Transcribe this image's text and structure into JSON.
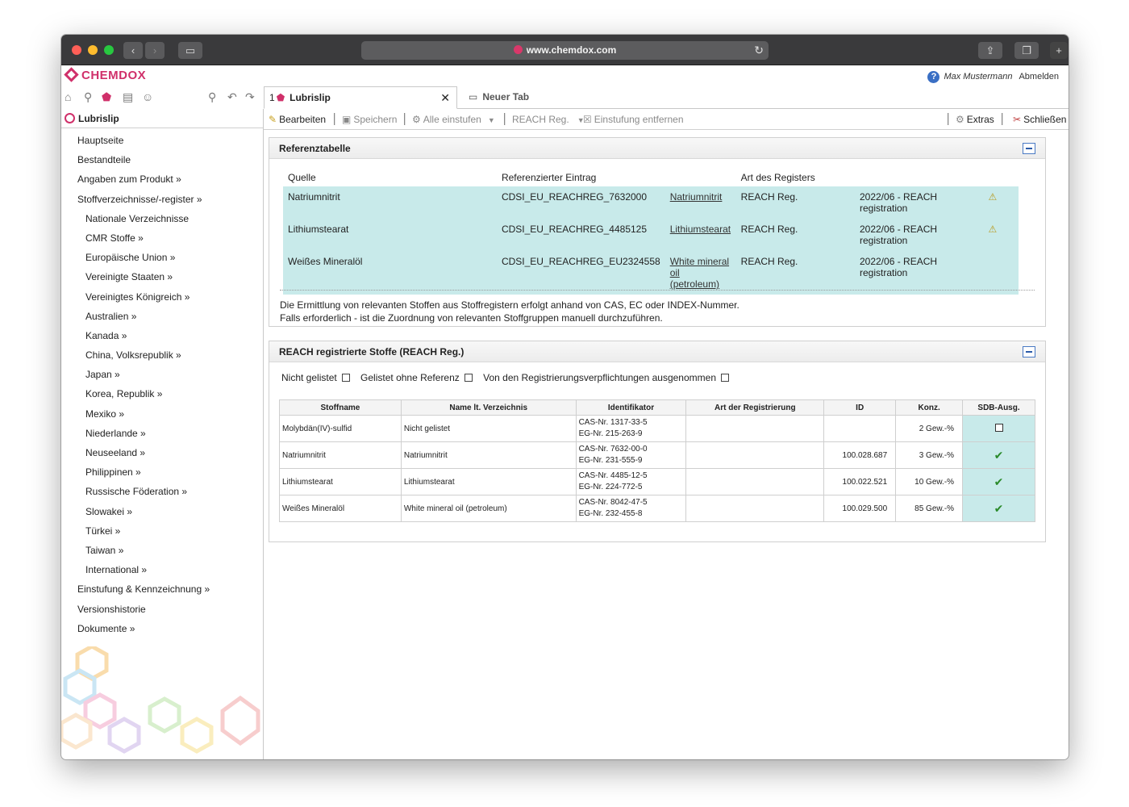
{
  "browser": {
    "url": "www.chemdox.com",
    "back_icon": "chevron-left-icon",
    "forward_icon": "chevron-right-icon"
  },
  "app": {
    "logo": "CHEMDOX",
    "user_name": "Max Mustermann",
    "logout": "Abmelden"
  },
  "tabs": [
    {
      "num": "1",
      "label": "Lubrislip",
      "close": "✕"
    },
    {
      "label": "Neuer Tab"
    }
  ],
  "sidebar": {
    "title": "Lubrislip",
    "items": [
      {
        "label": "Hauptseite",
        "sub": false
      },
      {
        "label": "Bestandteile",
        "sub": false
      },
      {
        "label": "Angaben zum Produkt »",
        "sub": false
      },
      {
        "label": "Stoffverzeichnisse/-register »",
        "sub": false
      },
      {
        "label": "Nationale Verzeichnisse",
        "sub": true
      },
      {
        "label": "CMR Stoffe »",
        "sub": true
      },
      {
        "label": "Europäische Union »",
        "sub": true
      },
      {
        "label": "Vereinigte Staaten »",
        "sub": true
      },
      {
        "label": "Vereinigtes Königreich »",
        "sub": true
      },
      {
        "label": "Australien »",
        "sub": true
      },
      {
        "label": "Kanada »",
        "sub": true
      },
      {
        "label": "China, Volksrepublik »",
        "sub": true
      },
      {
        "label": "Japan »",
        "sub": true
      },
      {
        "label": "Korea, Republik »",
        "sub": true
      },
      {
        "label": "Mexiko »",
        "sub": true
      },
      {
        "label": "Niederlande »",
        "sub": true
      },
      {
        "label": "Neuseeland »",
        "sub": true
      },
      {
        "label": "Philippinen »",
        "sub": true
      },
      {
        "label": "Russische Föderation »",
        "sub": true
      },
      {
        "label": "Slowakei »",
        "sub": true
      },
      {
        "label": "Türkei »",
        "sub": true
      },
      {
        "label": "Taiwan »",
        "sub": true
      },
      {
        "label": "International »",
        "sub": true
      },
      {
        "label": "Einstufung & Kennzeichnung »",
        "sub": false
      },
      {
        "label": "Versionshistorie",
        "sub": false
      },
      {
        "label": "Dokumente »",
        "sub": false
      }
    ]
  },
  "toolbar": {
    "edit": "Bearbeiten",
    "save": "Speichern",
    "classify_all": "Alle einstufen",
    "reach": "REACH Reg.",
    "remove_classification": "Einstufung entfernen",
    "extras": "Extras",
    "close": "Schließen"
  },
  "ref_panel": {
    "title": "Referenztabelle",
    "headers": [
      "Quelle",
      "Referenzierter Eintrag",
      "Art des Registers"
    ],
    "rows": [
      {
        "source": "Natriumnitrit",
        "entry": "CDSI_EU_REACHREG_7632000",
        "link": "Natriumnitrit",
        "register": "REACH Reg.",
        "version": "2022/06 - REACH registration",
        "doc": true
      },
      {
        "source": "Lithiumstearat",
        "entry": "CDSI_EU_REACHREG_4485125",
        "link": "Lithiumstearat",
        "register": "REACH Reg.",
        "version": "2022/06 - REACH registration",
        "doc": true
      },
      {
        "source": "Weißes Mineralöl",
        "entry": "CDSI_EU_REACHREG_EU2324558",
        "link": "White mineral oil (petroleum)",
        "register": "REACH Reg.",
        "version": "2022/06 - REACH registration",
        "doc": false
      }
    ],
    "note_line1": "Die Ermittlung von relevanten Stoffen aus Stoffregistern erfolgt anhand von CAS, EC oder INDEX-Nummer.",
    "note_line2": "Falls erforderlich - ist die Zuordnung von relevanten Stoffgruppen manuell durchzuführen."
  },
  "reach_panel": {
    "title": "REACH registrierte Stoffe (REACH Reg.)",
    "filters": [
      "Nicht gelistet",
      "Gelistet ohne Referenz",
      "Von den Registrierungsverpflichtungen ausgenommen"
    ],
    "headers": [
      "Stoffname",
      "Name lt. Verzeichnis",
      "Identifikator",
      "Art der Registrierung",
      "ID",
      "Konz.",
      "SDB-Ausg."
    ],
    "rows": [
      {
        "name": "Molybdän(IV)-sulfid",
        "listed_name": "Nicht gelistet",
        "cas": "CAS-Nr. 1317-33-5",
        "eg": "EG-Nr. 215-263-9",
        "reg_type": "",
        "id": "",
        "conc": "2 Gew.-%",
        "sdb": false
      },
      {
        "name": "Natriumnitrit",
        "listed_name": "Natriumnitrit",
        "cas": "CAS-Nr. 7632-00-0",
        "eg": "EG-Nr. 231-555-9",
        "reg_type": "",
        "id": "100.028.687",
        "conc": "3 Gew.-%",
        "sdb": true
      },
      {
        "name": "Lithiumstearat",
        "listed_name": "Lithiumstearat",
        "cas": "CAS-Nr. 4485-12-5",
        "eg": "EG-Nr. 224-772-5",
        "reg_type": "",
        "id": "100.022.521",
        "conc": "10 Gew.-%",
        "sdb": true
      },
      {
        "name": "Weißes Mineralöl",
        "listed_name": "White mineral oil (petroleum)",
        "cas": "CAS-Nr. 8042-47-5",
        "eg": "EG-Nr. 232-455-8",
        "reg_type": "",
        "id": "100.029.500",
        "conc": "85 Gew.-%",
        "sdb": true
      }
    ]
  },
  "colors": {
    "brand": "#d0306a",
    "row_highlight": "#c8eaea",
    "check": "#2a8a2a"
  }
}
